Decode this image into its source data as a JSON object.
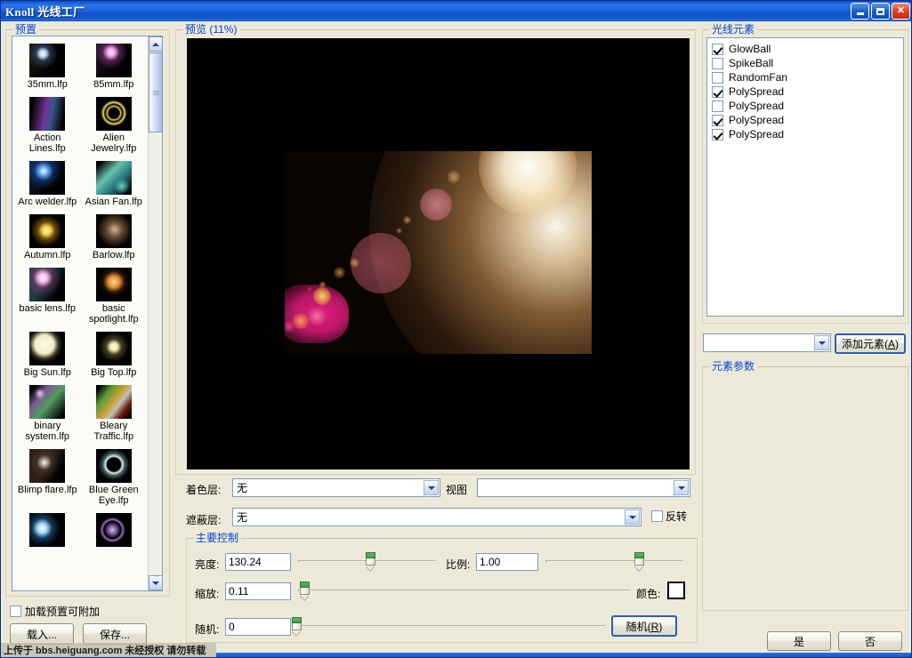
{
  "window": {
    "title": "Knoll  光线工厂",
    "minimize_label": "最小化",
    "maximize_label": "还原",
    "close_label": "关闭"
  },
  "preset_panel": {
    "group_label": "预置",
    "items": [
      {
        "name": "35mm.lfp",
        "thumb": "flare-white-small"
      },
      {
        "name": "85mm.lfp",
        "thumb": "flare-pink"
      },
      {
        "name": "Action Lines.lfp",
        "thumb": "streak-purple"
      },
      {
        "name": "Alien Jewelry.lfp",
        "thumb": "ring-yellow"
      },
      {
        "name": "Arc welder.lfp",
        "thumb": "flare-blue"
      },
      {
        "name": "Asian Fan.lfp",
        "thumb": "streak-teal"
      },
      {
        "name": "Autumn.lfp",
        "thumb": "burst-yellow"
      },
      {
        "name": "Barlow.lfp",
        "thumb": "soft-orange"
      },
      {
        "name": "basic lens.lfp",
        "thumb": "flare-magenta"
      },
      {
        "name": "basic spotlight.lfp",
        "thumb": "dot-orange"
      },
      {
        "name": "Big Sun.lfp",
        "thumb": "ball-cream"
      },
      {
        "name": "Big Top.lfp",
        "thumb": "burst-pale"
      },
      {
        "name": "binary system.lfp",
        "thumb": "streak-green"
      },
      {
        "name": "Bleary Traffic.lfp",
        "thumb": "streak-orange"
      },
      {
        "name": "Blimp flare.lfp",
        "thumb": "star-white"
      },
      {
        "name": "Blue Green Eye.lfp",
        "thumb": "eye-ring"
      },
      {
        "name": "",
        "thumb": "flare-cyan"
      },
      {
        "name": "",
        "thumb": "ring-violet"
      }
    ],
    "append_checkbox": {
      "label": "加载预置可附加",
      "checked": false
    },
    "load_button": "载入...",
    "save_button": "保存..."
  },
  "preview": {
    "group_label": "预览 (11%)",
    "zoom_percent": "11%"
  },
  "layers": {
    "color_layer_label": "着色层:",
    "color_layer_value": "无",
    "view_label": "视图",
    "view_value": "",
    "mask_layer_label": "遮蔽层:",
    "mask_layer_value": "无",
    "invert_label": "反转",
    "invert_checked": false
  },
  "main_controls": {
    "group_label": "主要控制",
    "brightness_label": "亮度:",
    "brightness_value": "130.24",
    "brightness_slider_pct": 52,
    "scale_label": "比例:",
    "scale_value": "1.00",
    "scale_slider_pct": 68,
    "zoom_label": "缩放:",
    "zoom_value": "0.11",
    "zoom_slider_pct": 2,
    "color_label": "颜色:",
    "color_value": "#ffffff",
    "random_label": "随机:",
    "random_value": "0",
    "random_slider_pct": 1,
    "random_button": "随机(R)",
    "random_button_accesskey": "R"
  },
  "elements_panel": {
    "group_label": "光线元素",
    "items": [
      {
        "name": "GlowBall",
        "checked": true
      },
      {
        "name": "SpikeBall",
        "checked": false
      },
      {
        "name": "RandomFan",
        "checked": false
      },
      {
        "name": "PolySpread",
        "checked": true
      },
      {
        "name": "PolySpread",
        "checked": false
      },
      {
        "name": "PolySpread",
        "checked": true
      },
      {
        "name": "PolySpread",
        "checked": true
      }
    ],
    "add_combo_value": "",
    "add_button_label": "添加元素(A)",
    "add_button_accesskey": "A",
    "params_group_label": "元素参数"
  },
  "dialog_buttons": {
    "ok": "是",
    "cancel": "否"
  },
  "watermark": {
    "text": "上传于 bbs.heiguang.com  未经授权  请勿转载"
  }
}
